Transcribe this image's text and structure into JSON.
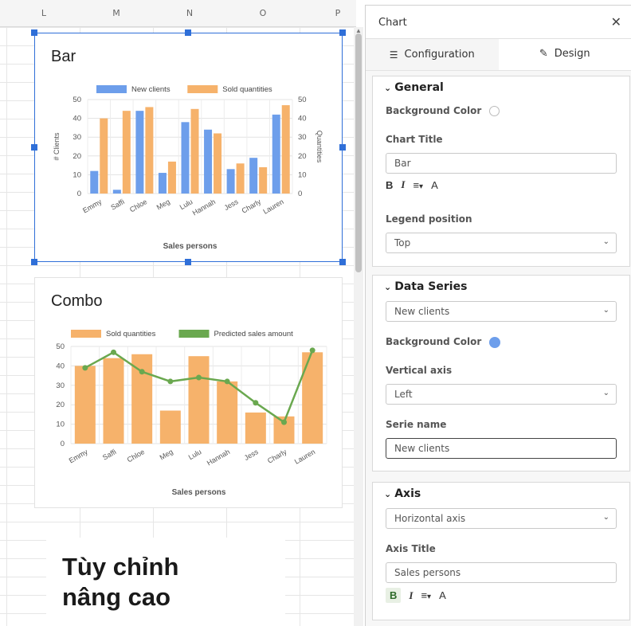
{
  "sheet": {
    "columns": [
      "L",
      "M",
      "N",
      "O",
      "P"
    ]
  },
  "charts": [
    {
      "title": "Bar",
      "legend": [
        "New clients",
        "Sold quantities"
      ],
      "xlabel": "Sales persons",
      "ylabel_left": "# Clients",
      "ylabel_right": "Quantities"
    },
    {
      "title": "Combo",
      "legend": [
        "Sold quantities",
        "Predicted sales amount"
      ],
      "xlabel": "Sales persons"
    }
  ],
  "chart_data": [
    {
      "type": "bar",
      "title": "Bar",
      "categories": [
        "Emmy",
        "Saffi",
        "Chloe",
        "Meg",
        "Lulu",
        "Hannah",
        "Jess",
        "Charly",
        "Lauren"
      ],
      "series": [
        {
          "name": "New clients",
          "color": "#6d9eeb",
          "axis": "left",
          "values": [
            12,
            2,
            44,
            11,
            38,
            34,
            13,
            19,
            42
          ]
        },
        {
          "name": "Sold quantities",
          "color": "#f6b26b",
          "axis": "right",
          "values": [
            40,
            44,
            46,
            17,
            45,
            32,
            16,
            14,
            47
          ]
        }
      ],
      "xlabel": "Sales persons",
      "ylabel": "# Clients",
      "ylabel_right": "Quantities",
      "ylim": [
        0,
        50
      ],
      "yticks": [
        0,
        10,
        20,
        30,
        40,
        50
      ],
      "legend_position": "top",
      "grid": true
    },
    {
      "type": "bar",
      "title": "Combo",
      "categories": [
        "Emmy",
        "Saffi",
        "Chloe",
        "Meg",
        "Lulu",
        "Hannah",
        "Jess",
        "Charly",
        "Lauren"
      ],
      "series": [
        {
          "name": "Sold quantities",
          "type": "bar",
          "color": "#f6b26b",
          "values": [
            40,
            44,
            46,
            17,
            45,
            32,
            16,
            14,
            47
          ]
        },
        {
          "name": "Predicted sales amount",
          "type": "line",
          "color": "#6aa84f",
          "values": [
            39,
            47,
            37,
            32,
            34,
            32,
            21,
            11,
            48
          ]
        }
      ],
      "xlabel": "Sales persons",
      "ylim": [
        0,
        50
      ],
      "yticks": [
        0,
        10,
        20,
        30,
        40,
        50
      ],
      "legend_position": "top",
      "grid": true
    }
  ],
  "caption": {
    "line1": "Tùy chỉnh",
    "line2": "nâng cao"
  },
  "panel": {
    "title": "Chart",
    "close_icon": "close-icon",
    "tabs": [
      {
        "label": "Configuration",
        "icon": "sliders-icon"
      },
      {
        "label": "Design",
        "icon": "paintbrush-icon",
        "active": true
      }
    ],
    "general": {
      "heading": "General",
      "bg_color_label": "Background Color",
      "chart_title_label": "Chart Title",
      "chart_title_value": "Bar",
      "legend_label": "Legend position",
      "legend_value": "Top"
    },
    "data_series": {
      "heading": "Data Series",
      "series_value": "New clients",
      "bg_color_label": "Background Color",
      "bg_color": "#6d9eeb",
      "vaxis_label": "Vertical axis",
      "vaxis_value": "Left",
      "serie_name_label": "Serie name",
      "serie_name_value": "New clients"
    },
    "axis": {
      "heading": "Axis",
      "axis_value": "Horizontal axis",
      "axis_title_label": "Axis Title",
      "axis_title_value": "Sales persons"
    },
    "format": {
      "bold": "B",
      "italic": "I",
      "align": "≡",
      "caret": "▾",
      "font_color": "A"
    }
  }
}
